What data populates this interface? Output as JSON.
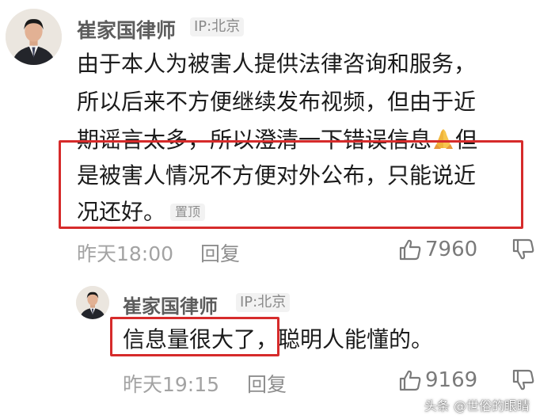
{
  "comment": {
    "author": "崔家国律师",
    "ip_label": "IP:北京",
    "lines": [
      "由于本人为被害人提供法律咨询和服务，",
      "所以后来不方便继续发布视频，但由于近",
      "期谣言太多，所以澄清一下错误信息",
      "是被害人情况不方便对外公布，只能说近",
      "况还好。"
    ],
    "line3_tail": "但",
    "pinned_badge": "置顶",
    "time": "昨天18:00",
    "reply_label": "回复",
    "likes": "7960"
  },
  "reply_comment": {
    "author": "崔家国律师",
    "ip_label": "IP:北京",
    "text_part1": "信息量很大了，",
    "text_part2": "聪明人能懂的。",
    "time": "昨天19:15",
    "reply_label": "回复",
    "likes": "9169"
  },
  "watermark": "头条 @世俗的眼睛",
  "colors": {
    "highlight_border": "#d62b2b",
    "author": "#5c5c5c",
    "meta": "#a3a3a3"
  },
  "icons": [
    "thumbs-up-icon",
    "thumbs-down-icon",
    "praying-hands-icon",
    "avatar-photo"
  ]
}
